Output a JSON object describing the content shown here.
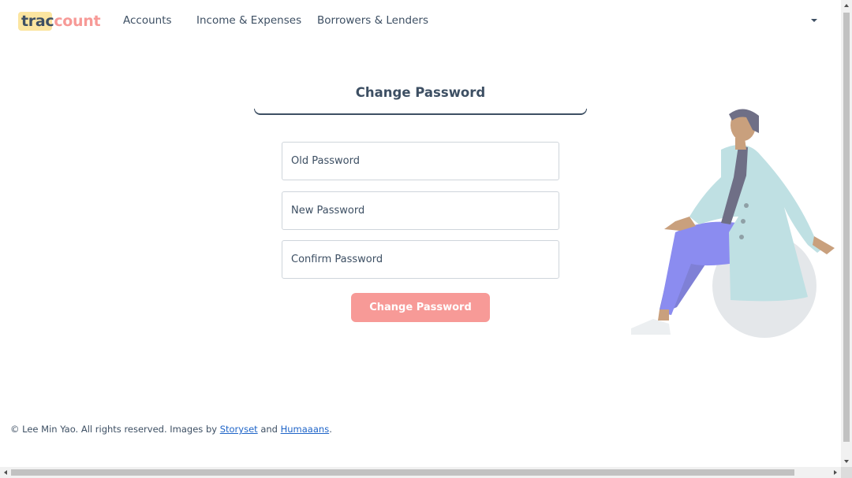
{
  "brand": {
    "part1": "trac",
    "part2": "count",
    "highlight_color": "#fbe5a0",
    "accent_color": "#f79a97"
  },
  "nav": {
    "items": [
      {
        "label": "Accounts"
      },
      {
        "label": "Income & Expenses"
      },
      {
        "label": "Borrowers & Lenders"
      }
    ],
    "user_menu_icon": "caret-down-icon"
  },
  "form": {
    "title": "Change Password",
    "old_password_placeholder": "Old Password",
    "new_password_placeholder": "New Password",
    "confirm_password_placeholder": "Confirm Password",
    "submit_label": "Change Password",
    "submit_color": "#f79a97"
  },
  "illustration": {
    "icon": "person-sitting-on-ball-illustration"
  },
  "footer": {
    "prefix": "© Lee Min Yao. All rights reserved. Images by ",
    "link1": "Storyset",
    "middle": " and ",
    "link2": "Humaaans",
    "suffix": "."
  },
  "colors": {
    "text": "#3d4f63",
    "link": "#1e64c8"
  }
}
